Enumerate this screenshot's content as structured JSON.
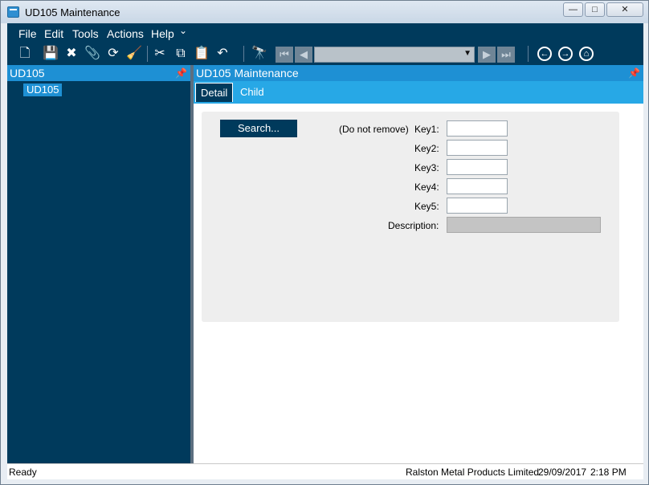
{
  "window": {
    "title": "UD105 Maintenance",
    "controls": [
      "—",
      "□",
      "✕"
    ]
  },
  "menu": {
    "items": [
      "File",
      "Edit",
      "Tools",
      "Actions",
      "Help"
    ],
    "overflow": "⌄"
  },
  "toolbar": {
    "icons": [
      "new-icon",
      "save-icon",
      "delete-icon",
      "attach-icon",
      "refresh-icon",
      "clear-icon",
      "cut-icon",
      "copy-icon",
      "paste-icon",
      "undo-icon",
      "search-icon",
      "first-icon",
      "previous-icon",
      "next-icon",
      "last-icon",
      "back-icon",
      "forward-icon",
      "home-icon"
    ],
    "nav_combo_value": ""
  },
  "tree_panel": {
    "title": "UD105",
    "items": [
      {
        "label": "UD105",
        "selected": true
      }
    ]
  },
  "main_panel": {
    "title": "UD105 Maintenance",
    "tabs": [
      {
        "label": "Detail",
        "active": true
      },
      {
        "label": "Child",
        "active": false
      }
    ],
    "form": {
      "search_button": "Search...",
      "note": "(Do not remove)",
      "fields": [
        {
          "label": "Key1:",
          "value": ""
        },
        {
          "label": "Key2:",
          "value": ""
        },
        {
          "label": "Key3:",
          "value": ""
        },
        {
          "label": "Key4:",
          "value": ""
        },
        {
          "label": "Key5:",
          "value": ""
        }
      ],
      "description": {
        "label": "Description:",
        "value": ""
      }
    }
  },
  "status": {
    "message": "Ready",
    "company": "Ralston Metal Products Limited",
    "date": "29/09/2017",
    "time": "2:18 PM"
  },
  "colors": {
    "navy": "#003a5c",
    "accent_blue": "#1e90d4",
    "tab_blue": "#27a8e6"
  }
}
